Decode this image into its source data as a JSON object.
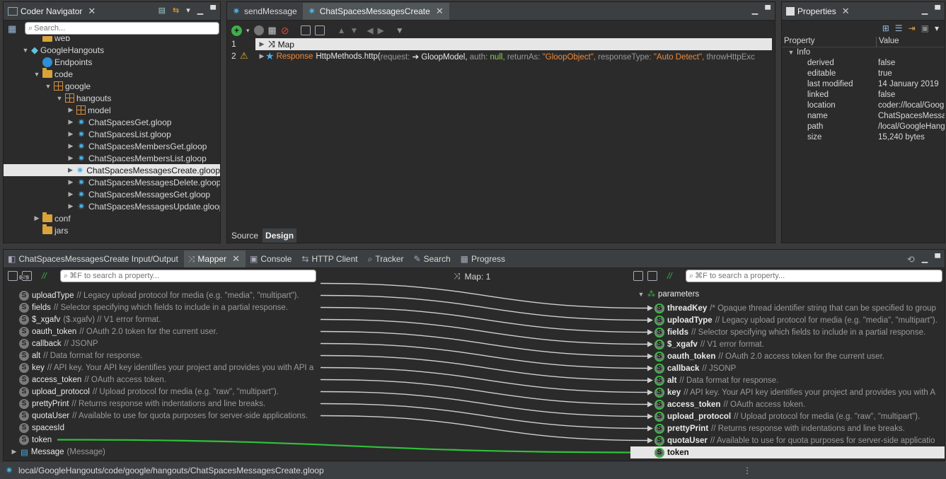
{
  "navigator": {
    "title": "Coder Navigator",
    "search_placeholder": "Search...",
    "items": [
      {
        "label": "web",
        "kind": "folder",
        "depth": 3
      },
      {
        "label": "GoogleHangouts",
        "kind": "cube",
        "depth": 2
      },
      {
        "label": "Endpoints",
        "kind": "endpoint",
        "depth": 3
      },
      {
        "label": "code",
        "kind": "folder",
        "depth": 3
      },
      {
        "label": "google",
        "kind": "package",
        "depth": 4
      },
      {
        "label": "hangouts",
        "kind": "package",
        "depth": 5
      },
      {
        "label": "model",
        "kind": "package",
        "depth": 6
      },
      {
        "label": "ChatSpacesGet.gloop",
        "kind": "service",
        "depth": 6
      },
      {
        "label": "ChatSpacesList.gloop",
        "kind": "service",
        "depth": 6
      },
      {
        "label": "ChatSpacesMembersGet.gloop",
        "kind": "service",
        "depth": 6
      },
      {
        "label": "ChatSpacesMembersList.gloop",
        "kind": "service",
        "depth": 6
      },
      {
        "label": "ChatSpacesMessagesCreate.gloop",
        "kind": "service",
        "depth": 6,
        "selected": true
      },
      {
        "label": "ChatSpacesMessagesDelete.gloop",
        "kind": "service",
        "depth": 6
      },
      {
        "label": "ChatSpacesMessagesGet.gloop",
        "kind": "service",
        "depth": 6
      },
      {
        "label": "ChatSpacesMessagesUpdate.gloop",
        "kind": "service",
        "depth": 6
      },
      {
        "label": "conf",
        "kind": "folder",
        "depth": 3
      },
      {
        "label": "jars",
        "kind": "folder",
        "depth": 3
      }
    ]
  },
  "editor": {
    "tabs": [
      {
        "label": "sendMessage",
        "active": false
      },
      {
        "label": "ChatSpacesMessagesCreate",
        "active": true
      }
    ],
    "lines": [
      {
        "num": "1",
        "text": "Map"
      },
      {
        "num": "2",
        "response_kw": "Response",
        "call": "HttpMethods.http(",
        "args": [
          {
            "k": " request:",
            "v": " ➔ GloopModel,",
            "type": "plain"
          },
          {
            "k": " auth:",
            "v": " null,",
            "type": "null"
          },
          {
            "k": " returnAs:",
            "v": " \"GloopObject\",",
            "type": "str"
          },
          {
            "k": " responseType:",
            "v": " \"Auto Detect\",",
            "type": "str"
          },
          {
            "k": " throwHttpExc",
            "v": "",
            "type": "plain"
          }
        ]
      }
    ],
    "bottom_tabs": [
      "Source",
      "Design"
    ]
  },
  "properties": {
    "title": "Properties",
    "col_property": "Property",
    "col_value": "Value",
    "group": "Info",
    "rows": [
      {
        "k": "derived",
        "v": "false"
      },
      {
        "k": "editable",
        "v": "true"
      },
      {
        "k": "last modified",
        "v": "14 January 2019"
      },
      {
        "k": "linked",
        "v": "false"
      },
      {
        "k": "location",
        "v": "coder://local/Goog"
      },
      {
        "k": "name",
        "v": "ChatSpacesMessa"
      },
      {
        "k": "path",
        "v": "/local/GoogleHang"
      },
      {
        "k": "size",
        "v": "15,240  bytes"
      }
    ]
  },
  "bottom_tabs": [
    {
      "label": "ChatSpacesMessagesCreate Input/Output",
      "active": false
    },
    {
      "label": "Mapper",
      "active": true
    },
    {
      "label": "Console",
      "active": false
    },
    {
      "label": "HTTP Client",
      "active": false
    },
    {
      "label": "Tracker",
      "active": false
    },
    {
      "label": "Search",
      "active": false
    },
    {
      "label": "Progress",
      "active": false
    }
  ],
  "mapper": {
    "search_placeholder": "⌘F to search a property...",
    "map_label": "Map: 1",
    "left": [
      {
        "name": "uploadType",
        "c": " // Legacy upload protocol for media (e.g. \"media\", \"multipart\")."
      },
      {
        "name": "fields",
        "c": " // Selector specifying which fields to include in a partial response."
      },
      {
        "name": "$_xgafv",
        "c": " ($.xgafv) // V1 error format."
      },
      {
        "name": "oauth_token",
        "c": " // OAuth 2.0 token for the current user."
      },
      {
        "name": "callback",
        "c": " // JSONP"
      },
      {
        "name": "alt",
        "c": " // Data format for response."
      },
      {
        "name": "key",
        "c": " // API key. Your API key identifies your project and provides you with API a"
      },
      {
        "name": "access_token",
        "c": " // OAuth access token."
      },
      {
        "name": "upload_protocol",
        "c": " // Upload protocol for media (e.g. \"raw\", \"multipart\")."
      },
      {
        "name": "prettyPrint",
        "c": " // Returns response with indentations and line breaks."
      },
      {
        "name": "quotaUser",
        "c": " // Available to use for quota purposes for server-side applications."
      },
      {
        "name": "spacesId",
        "c": ""
      },
      {
        "name": "token",
        "c": ""
      },
      {
        "name": "Message",
        "c": " (Message)"
      }
    ],
    "right_parent": "parameters",
    "right": [
      {
        "name": "threadKey",
        "c": " /* Opaque thread identifier string that can be specified to group"
      },
      {
        "name": "uploadType",
        "c": " // Legacy upload protocol for media (e.g. \"media\", \"multipart\")."
      },
      {
        "name": "fields",
        "c": " // Selector specifying which fields to include in a partial response."
      },
      {
        "name": "$_xgafv",
        "c": " // V1 error format."
      },
      {
        "name": "oauth_token",
        "c": " // OAuth 2.0 access token for the current user."
      },
      {
        "name": "callback",
        "c": " // JSONP"
      },
      {
        "name": "alt",
        "c": " // Data format for response."
      },
      {
        "name": "key",
        "c": " // API key. Your API key identifies your project and provides you with A"
      },
      {
        "name": "access_token",
        "c": " // OAuth access token."
      },
      {
        "name": "upload_protocol",
        "c": " // Upload protocol for media (e.g. \"raw\", \"multipart\")."
      },
      {
        "name": "prettyPrint",
        "c": " // Returns response with indentations and line breaks."
      },
      {
        "name": "quotaUser",
        "c": " // Available to use for quota purposes for server-side applicatio"
      },
      {
        "name": "token",
        "c": "",
        "selected": true
      }
    ]
  },
  "status": {
    "path": "local/GoogleHangouts/code/google/hangouts/ChatSpacesMessagesCreate.gloop"
  },
  "colors": {
    "link_line": "#cfcfcf",
    "active_link": "#2fc23a",
    "string": "#f08a3a",
    "null": "#8fd14f"
  }
}
